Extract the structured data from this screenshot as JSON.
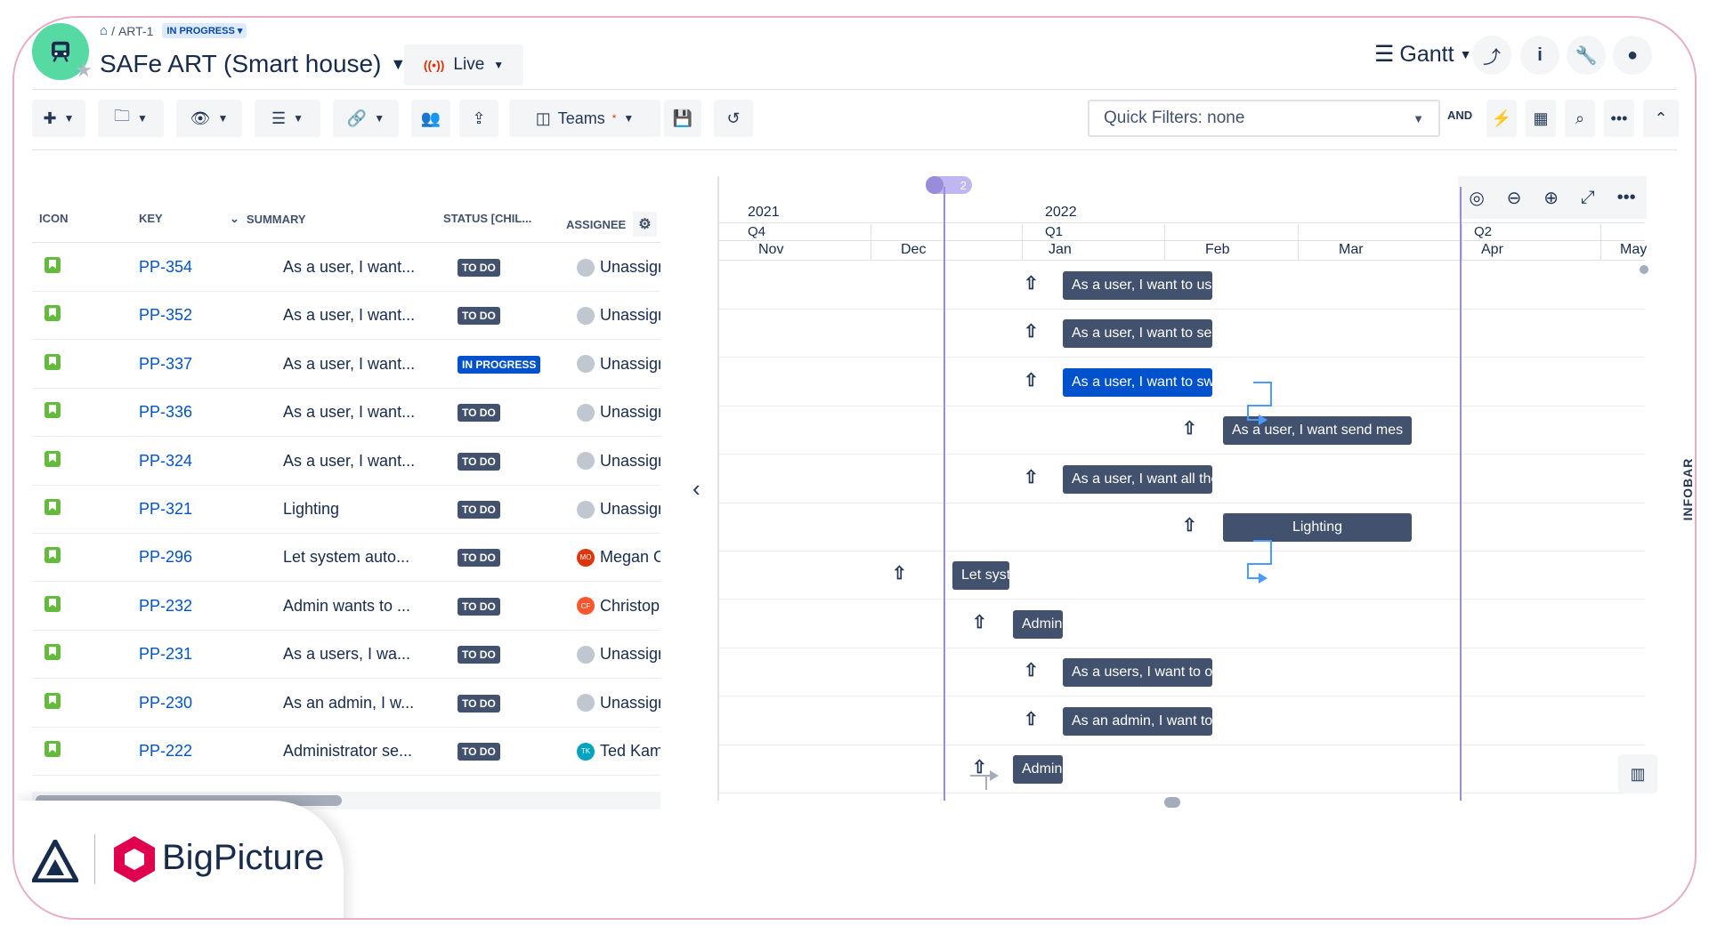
{
  "header": {
    "breadcrumb": "ART-1",
    "status": "IN PROGRESS",
    "title": "SAFe ART (Smart house)",
    "live_label": "Live",
    "view_label": "Gantt"
  },
  "toolbar": {
    "teams_label": "Teams",
    "teams_marker": "*",
    "quick_filters": "Quick Filters: none",
    "and_label": "AND"
  },
  "table": {
    "columns": [
      "ICON",
      "KEY",
      "SUMMARY",
      "STATUS [CHIL...",
      "ASSIGNEE"
    ],
    "rows": [
      {
        "key": "PP-354",
        "summary": "As a user, I want...",
        "status": "TO DO",
        "assignee": "Unassign",
        "initials": ""
      },
      {
        "key": "PP-352",
        "summary": "As a user, I want...",
        "status": "TO DO",
        "assignee": "Unassign",
        "initials": ""
      },
      {
        "key": "PP-337",
        "summary": "As a user, I want...",
        "status": "IN PROGRESS",
        "assignee": "Unassign",
        "initials": ""
      },
      {
        "key": "PP-336",
        "summary": "As a user, I want...",
        "status": "TO DO",
        "assignee": "Unassign",
        "initials": ""
      },
      {
        "key": "PP-324",
        "summary": "As a user, I want...",
        "status": "TO DO",
        "assignee": "Unassign",
        "initials": ""
      },
      {
        "key": "PP-321",
        "summary": "Lighting",
        "status": "TO DO",
        "assignee": "Unassign",
        "initials": ""
      },
      {
        "key": "PP-296",
        "summary": "Let system auto...",
        "status": "TO DO",
        "assignee": "Megan O",
        "initials": "MO"
      },
      {
        "key": "PP-232",
        "summary": "Admin wants to ...",
        "status": "TO DO",
        "assignee": "Christoph",
        "initials": "CF"
      },
      {
        "key": "PP-231",
        "summary": "As a users, I wa...",
        "status": "TO DO",
        "assignee": "Unassign",
        "initials": ""
      },
      {
        "key": "PP-230",
        "summary": "As an admin, I w...",
        "status": "TO DO",
        "assignee": "Unassign",
        "initials": ""
      },
      {
        "key": "PP-222",
        "summary": "Administrator se...",
        "status": "TO DO",
        "assignee": "Ted Kami",
        "initials": "TK"
      }
    ]
  },
  "gantt": {
    "years": [
      "2021",
      "2022"
    ],
    "quarters": [
      "Q4",
      "Q1",
      "Q2"
    ],
    "months": [
      "Nov",
      "Dec",
      "Jan",
      "Feb",
      "Mar",
      "Apr",
      "May"
    ],
    "marker_count": "2",
    "bars": [
      "As a user, I want to use th",
      "As a user, I want to select",
      "As a user, I want to switch",
      "As a user, I want send mes",
      "As a user, I want all the fe",
      "Lighting",
      "Let syst",
      "Admin",
      "As a users, I want to oper",
      "As an admin, I want to mo",
      "Admin"
    ],
    "infobar": "INFOBAR"
  },
  "brand": {
    "name": "BigPicture",
    "accent": "#e0004d"
  }
}
